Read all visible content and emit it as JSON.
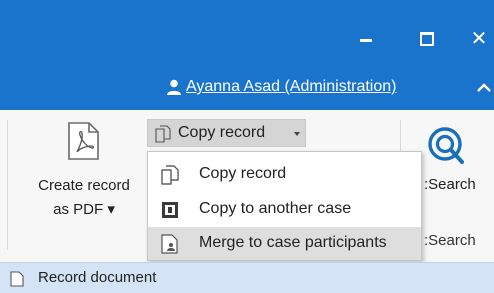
{
  "window": {
    "minimize_icon": "minimize-icon",
    "maximize_icon": "maximize-icon",
    "close_glyph": "✕"
  },
  "user": {
    "name": "Ayanna Asad (Administration)",
    "icon": "user-icon"
  },
  "ribbon": {
    "create_pdf": {
      "line1": "Create record",
      "line2": "as PDF ▾",
      "icon": "pdf-icon"
    },
    "copy_record": {
      "label": "Copy record",
      "icon": "document-copy-icon"
    },
    "search": {
      "label": ":Search",
      "group_label": ":Search",
      "icon": "search-icon"
    }
  },
  "dropdown": {
    "items": [
      {
        "label": "Copy record",
        "icon": "document-copy-icon"
      },
      {
        "label": "Copy to another case",
        "icon": "copy-case-icon"
      },
      {
        "label": "Merge to case participants",
        "icon": "merge-participants-icon"
      }
    ],
    "highlighted_index": 2
  },
  "statusbar": {
    "label": "Record document",
    "icon": "document-icon"
  },
  "colors": {
    "titlebar": "#1a74cc",
    "statusbar": "#d4e4f6",
    "accent": "#1a6fbd",
    "highlight": "#dedede"
  }
}
